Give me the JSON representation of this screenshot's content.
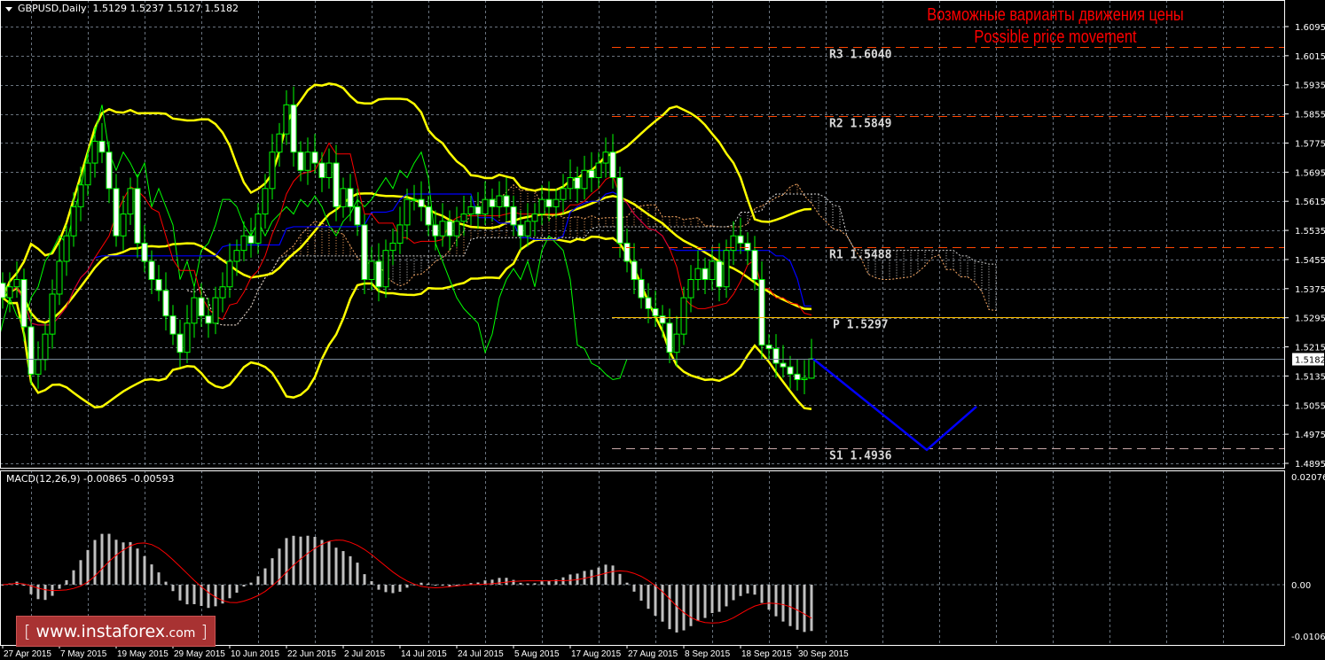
{
  "header": {
    "symbol": "GBPUSD,Daily",
    "ohlc": "1.5129 1.5237 1.5127 1.5182"
  },
  "annotation": {
    "title_ru": "Возможные варианты движения цены",
    "title_en": "Possible price movement"
  },
  "macd_header": "MACD(12,26,9) -0.00865 -0.00593",
  "watermark": {
    "open": "[",
    "text": "www.instaforex",
    "suffix": ".com",
    "close": "]"
  },
  "colors": {
    "background": "#000000",
    "grid": "#8c9aa8",
    "candle_wick": "#00ff00",
    "bull_body": "#000000",
    "bear_body": "#ffffff",
    "bollinger": "#ffff00",
    "tenkan": "#ff0000",
    "kijun": "#0000ff",
    "chikou": "#00ff00",
    "cloud_up": "#f4a460",
    "cloud_down": "#d3d3d3",
    "macd_hist": "#c0c0c0",
    "macd_signal": "#ff0000",
    "forecast": "#0000ff",
    "current_price": "#778899"
  },
  "chart_data": {
    "type": "candlestick",
    "title": "GBPUSD,Daily",
    "price_axis": {
      "range": [
        1.4895,
        1.6095
      ],
      "ticks": [
        "1.6095",
        "1.6015",
        "1.5935",
        "1.5855",
        "1.5775",
        "1.5695",
        "1.5615",
        "1.5535",
        "1.5455",
        "1.5375",
        "1.5295",
        "1.5215",
        "1.5135",
        "1.5055",
        "1.4975",
        "1.4895"
      ],
      "current_price": "1.5182"
    },
    "x_ticks": [
      {
        "label": "27 Apr 2015",
        "bar": 0
      },
      {
        "label": "7 May 2015",
        "bar": 8
      },
      {
        "label": "19 May 2015",
        "bar": 16
      },
      {
        "label": "29 May 2015",
        "bar": 24
      },
      {
        "label": "10 Jun 2015",
        "bar": 32
      },
      {
        "label": "22 Jun 2015",
        "bar": 40
      },
      {
        "label": "2 Jul 2015",
        "bar": 48
      },
      {
        "label": "14 Jul 2015",
        "bar": 56
      },
      {
        "label": "24 Jul 2015",
        "bar": 64
      },
      {
        "label": "5 Aug 2015",
        "bar": 72
      },
      {
        "label": "17 Aug 2015",
        "bar": 80
      },
      {
        "label": "27 Aug 2015",
        "bar": 88
      },
      {
        "label": "8 Sep 2015",
        "bar": 96
      },
      {
        "label": "18 Sep 2015",
        "bar": 104
      },
      {
        "label": "30 Sep 2015",
        "bar": 112
      }
    ],
    "closes": [
      1.535,
      1.538,
      1.54,
      1.527,
      1.514,
      1.518,
      1.525,
      1.536,
      1.545,
      1.552,
      1.56,
      1.566,
      1.572,
      1.578,
      1.575,
      1.565,
      1.552,
      1.558,
      1.565,
      1.55,
      1.545,
      1.54,
      1.537,
      1.53,
      1.525,
      1.52,
      1.528,
      1.535,
      1.53,
      1.528,
      1.535,
      1.538,
      1.545,
      1.548,
      1.552,
      1.55,
      1.558,
      1.565,
      1.575,
      1.58,
      1.588,
      1.575,
      1.57,
      1.575,
      1.572,
      1.568,
      1.572,
      1.56,
      1.565,
      1.56,
      1.555,
      1.54,
      1.545,
      1.538,
      1.548,
      1.55,
      1.555,
      1.562,
      1.562,
      1.56,
      1.555,
      1.552,
      1.556,
      1.552,
      1.556,
      1.558,
      1.56,
      1.558,
      1.562,
      1.56,
      1.563,
      1.56,
      1.555,
      1.552,
      1.556,
      1.558,
      1.562,
      1.56,
      1.562,
      1.565,
      1.568,
      1.565,
      1.57,
      1.568,
      1.572,
      1.575,
      1.568,
      1.55,
      1.545,
      1.54,
      1.535,
      1.532,
      1.53,
      1.528,
      1.52,
      1.525,
      1.535,
      1.54,
      1.543,
      1.54,
      1.545,
      1.538,
      1.548,
      1.552,
      1.55,
      1.548,
      1.54,
      1.522,
      1.521,
      1.517,
      1.516,
      1.514,
      1.5125,
      1.5129,
      1.5182
    ],
    "last_candle": {
      "open": 1.5129,
      "high": 1.5237,
      "low": 1.5127,
      "close": 1.5182
    },
    "indicators": {
      "bollinger": {
        "period": 20,
        "deviation": 2
      },
      "ichimoku": {
        "tenkan": 9,
        "kijun": 26,
        "senkou_b": 52,
        "shift": 26
      },
      "macd": {
        "fast": 12,
        "slow": 26,
        "signal": 9,
        "value": -0.00865,
        "signal_value": -0.00593
      }
    },
    "levels": [
      {
        "name": "R3",
        "value": 1.604,
        "label": "R3 1.6040",
        "color": "#ff4500",
        "style": "dashed"
      },
      {
        "name": "R2",
        "value": 1.5849,
        "label": "R2 1.5849",
        "color": "#ff4500",
        "style": "dashed"
      },
      {
        "name": "R1",
        "value": 1.5488,
        "label": "R1 1.5488",
        "color": "#ff4500",
        "style": "dashed"
      },
      {
        "name": "P",
        "value": 1.5297,
        "label": "P 1.5297",
        "color": "#ffc000",
        "style": "solid"
      },
      {
        "name": "S1",
        "value": 1.4936,
        "label": "S1 1.4936",
        "color": "#c8a8a8",
        "style": "dashed"
      }
    ],
    "forecast": [
      [
        114,
        1.5182
      ],
      [
        130,
        1.4932
      ],
      [
        137,
        1.5051
      ]
    ],
    "macd_axis": {
      "range": [
        -0.01062,
        0.02076
      ],
      "ticks": [
        "0.02076",
        "0.00",
        "-0.01062"
      ]
    }
  }
}
